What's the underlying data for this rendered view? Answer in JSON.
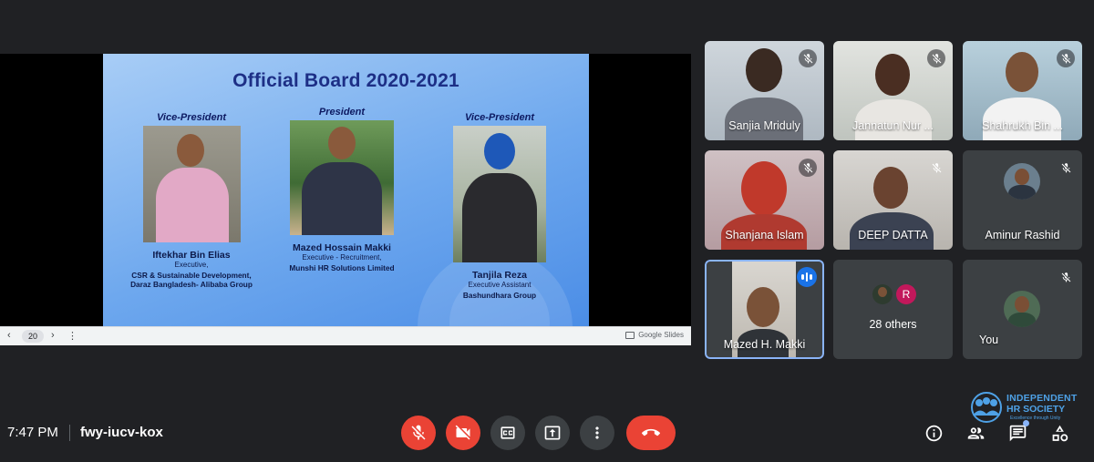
{
  "slide": {
    "title": "Official Board 2020-2021",
    "members": [
      {
        "role": "Vice-President",
        "name": "Iftekhar Bin Elias",
        "lines": [
          "Executive,",
          "CSR & Sustainable Development,",
          "Daraz Bangladesh- Alibaba Group"
        ]
      },
      {
        "role": "President",
        "name": "Mazed Hossain Makki",
        "lines": [
          "Executive - Recruitment,",
          "Munshi HR Solutions Limited"
        ]
      },
      {
        "role": "Vice-President",
        "name": "Tanjila Reza",
        "lines": [
          "Executive Assistant",
          "Bashundhara Group"
        ]
      }
    ],
    "page_number": "20",
    "prev_glyph": "‹",
    "next_glyph": "›",
    "more_glyph": "⋮",
    "provider": "Google Slides"
  },
  "participants": [
    {
      "name": "Sanjia Mriduly",
      "muted": true,
      "video": true
    },
    {
      "name": "Jannatun Nur ...",
      "muted": true,
      "video": true
    },
    {
      "name": "Shahrukh Bin ...",
      "muted": true,
      "video": true
    },
    {
      "name": "Shanjana Islam",
      "muted": true,
      "video": true
    },
    {
      "name": "DEEP DATTA",
      "muted": true,
      "video": true
    },
    {
      "name": "Aminur Rashid",
      "muted": true,
      "video": false
    },
    {
      "name": "Mazed H. Makki",
      "muted": false,
      "speaking": true,
      "video": true
    },
    {
      "name": "You",
      "muted": true,
      "video": false
    }
  ],
  "others": {
    "label": "28 others",
    "avatar_letter": "R"
  },
  "bottom": {
    "time": "7:47 PM",
    "meeting_code": "fwy-iucv-kox"
  },
  "logo": {
    "line1": "INDEPENDENT",
    "line2": "HR SOCIETY",
    "tagline": "Excellence through Unity"
  },
  "colors": {
    "background": "#202124",
    "tile": "#3c4043",
    "danger": "#ea4335",
    "accent": "#8ab4f8",
    "speaking": "#1a73e8",
    "slide_title": "#1d2f86"
  },
  "icons": [
    "mic-off-icon",
    "camera-off-icon",
    "captions-icon",
    "present-icon",
    "more-vert-icon",
    "hang-up-icon",
    "info-icon",
    "people-icon",
    "chat-icon",
    "activities-icon"
  ]
}
